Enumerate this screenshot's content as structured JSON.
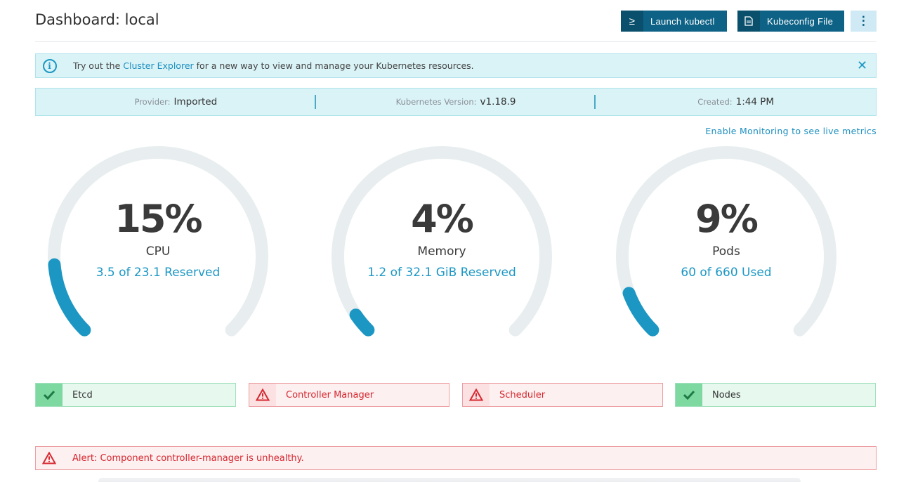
{
  "header": {
    "title": "Dashboard: local",
    "kubectl_icon": "≥",
    "kubectl_label": "Launch kubectl",
    "kubeconfig_label": "Kubeconfig File",
    "more_icon": "⋮"
  },
  "banner": {
    "text_before": "Try out the",
    "link": "Cluster Explorer",
    "text_after": "for a new way to view and manage your Kubernetes resources.",
    "close": "✕"
  },
  "info": {
    "provider_key": "Provider:",
    "provider_value": "Imported",
    "version_key": "Kubernetes Version:",
    "version_value": "v1.18.9",
    "created_key": "Created:",
    "created_value": "1:44 PM"
  },
  "monitoring_link": "Enable Monitoring to see live metrics",
  "gauges": [
    {
      "percent": "15%",
      "name": "CPU",
      "detail": "3.5 of 23.1 Reserved",
      "value": 0.15
    },
    {
      "percent": "4%",
      "name": "Memory",
      "detail": "1.2 of 32.1 GiB Reserved",
      "value": 0.04
    },
    {
      "percent": "9%",
      "name": "Pods",
      "detail": "60 of 660 Used",
      "value": 0.09
    }
  ],
  "components": [
    {
      "label": "Etcd",
      "status": "ok"
    },
    {
      "label": "Controller Manager",
      "status": "error"
    },
    {
      "label": "Scheduler",
      "status": "error"
    },
    {
      "label": "Nodes",
      "status": "ok"
    }
  ],
  "alert": {
    "text": "Alert: Component controller-manager is unhealthy."
  },
  "colors": {
    "primary": "#0d6286",
    "accent": "#1c97c4",
    "gauge_track": "#e8eeef",
    "ok": "#7dd9a0",
    "error": "#d6272f"
  }
}
